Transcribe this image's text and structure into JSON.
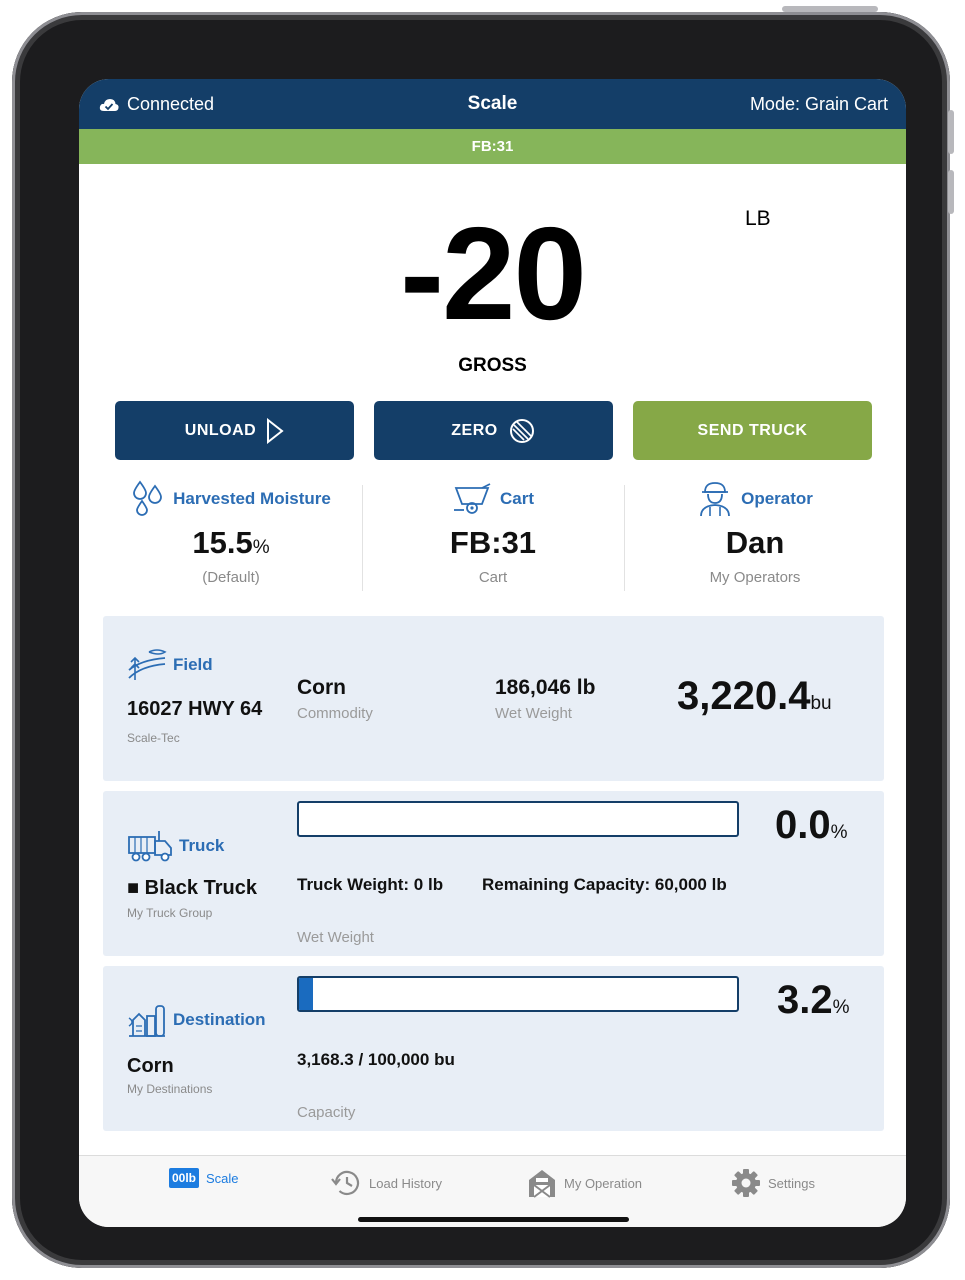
{
  "header": {
    "connection_status": "Connected",
    "title": "Scale",
    "mode": "Mode: Grain Cart",
    "cart_banner": "FB:31"
  },
  "scale": {
    "weight": "-20",
    "unit": "LB",
    "weight_type": "GROSS"
  },
  "actions": {
    "unload_label": "UNLOAD",
    "zero_label": "ZERO",
    "send_truck_label": "SEND TRUCK"
  },
  "info": {
    "moisture": {
      "label": "Harvested Moisture",
      "value": "15.5",
      "unit": "%",
      "sub": "(Default)"
    },
    "cart": {
      "label": "Cart",
      "value": "FB:31",
      "sub": "Cart"
    },
    "operator": {
      "label": "Operator",
      "value": "Dan",
      "sub": "My Operators"
    }
  },
  "field_card": {
    "label": "Field",
    "name": "16027 HWY 64",
    "owner": "Scale-Tec",
    "commodity_value": "Corn",
    "commodity_label": "Commodity",
    "wet_weight_value": "186,046 lb",
    "wet_weight_label": "Wet Weight",
    "bushels": "3,220.4",
    "bushels_unit": "bu"
  },
  "truck_card": {
    "label": "Truck",
    "marker": "■",
    "name": "Black Truck",
    "group": "My Truck Group",
    "progress_fraction": 0.0,
    "percent": "0.0",
    "percent_unit": "%",
    "truck_weight": "Truck Weight: 0 lb",
    "remaining_capacity": "Remaining Capacity: 60,000 lb",
    "basis": "Wet Weight"
  },
  "destination_card": {
    "label": "Destination",
    "name": "Corn",
    "group": "My Destinations",
    "progress_fraction": 0.032,
    "percent": "3.2",
    "percent_unit": "%",
    "amount": "3,168.3 / 100,000 bu",
    "basis": "Capacity"
  },
  "tabbar": {
    "items": [
      {
        "label": "Scale",
        "icon": "scale-icon",
        "icon_text": "00lb",
        "active": true
      },
      {
        "label": "Load History",
        "icon": "history-icon",
        "active": false
      },
      {
        "label": "My Operation",
        "icon": "barn-icon",
        "active": false
      },
      {
        "label": "Settings",
        "icon": "gear-icon",
        "active": false
      }
    ]
  },
  "colors": {
    "header_blue": "#143e68",
    "banner_green": "#86b55a",
    "send_green": "#86a847",
    "accent_blue": "#2c6db4",
    "card_bg": "#e8eef6",
    "progress_fill": "#1a6bbf",
    "tab_active": "#1c7ce0"
  }
}
